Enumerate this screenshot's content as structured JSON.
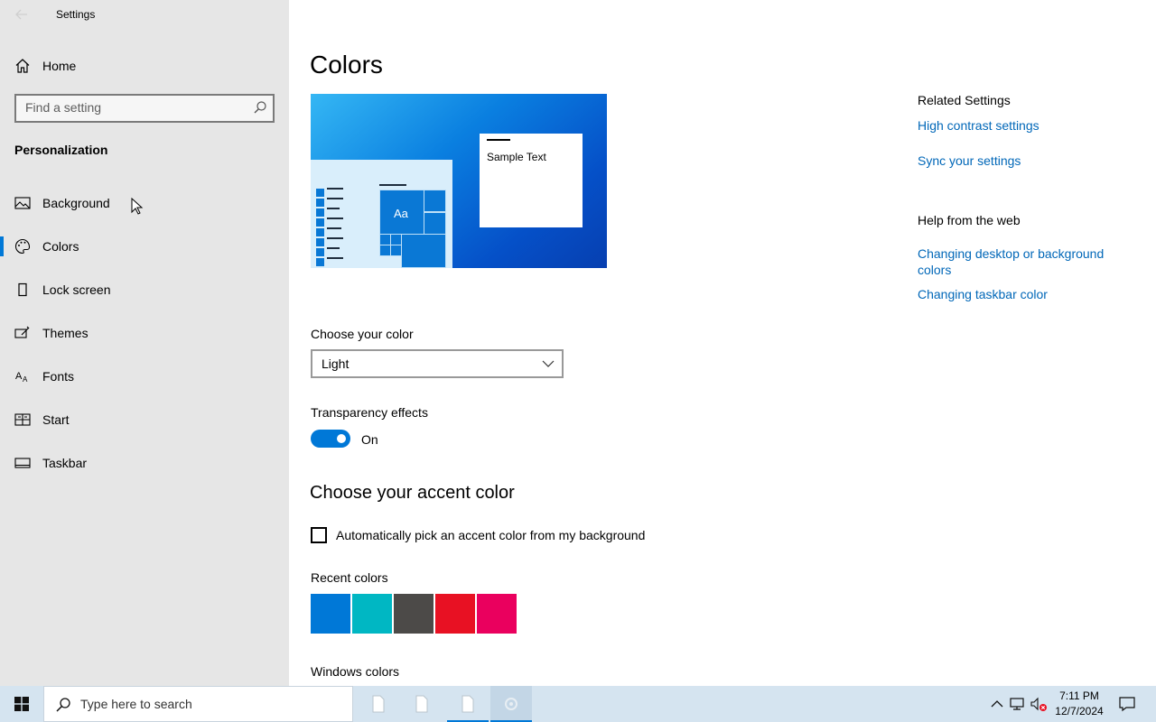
{
  "window": {
    "title": "Settings"
  },
  "sidebar": {
    "home_label": "Home",
    "search_placeholder": "Find a setting",
    "section_title": "Personalization",
    "items": [
      {
        "label": "Background",
        "icon": "picture-icon"
      },
      {
        "label": "Colors",
        "icon": "palette-icon",
        "selected": true
      },
      {
        "label": "Lock screen",
        "icon": "lock-screen-icon"
      },
      {
        "label": "Themes",
        "icon": "themes-icon"
      },
      {
        "label": "Fonts",
        "icon": "fonts-icon"
      },
      {
        "label": "Start",
        "icon": "start-icon"
      },
      {
        "label": "Taskbar",
        "icon": "taskbar-icon"
      }
    ]
  },
  "main": {
    "title": "Colors",
    "preview": {
      "sample_text": "Sample Text",
      "tile_label": "Aa"
    },
    "choose_color": {
      "label": "Choose your color",
      "value": "Light"
    },
    "transparency": {
      "label": "Transparency effects",
      "state": "On"
    },
    "accent": {
      "heading": "Choose your accent color",
      "auto_pick_label": "Automatically pick an accent color from my background",
      "auto_pick_checked": false,
      "recent_label": "Recent colors",
      "recent_colors": [
        "#0078d7",
        "#00b7c3",
        "#4c4a48",
        "#e81123",
        "#ea005e"
      ],
      "windows_colors_label": "Windows colors"
    }
  },
  "related": {
    "related_title": "Related Settings",
    "related_links": [
      "High contrast settings",
      "Sync your settings"
    ],
    "help_title": "Help from the web",
    "help_links": [
      "Changing desktop or background colors",
      "Changing taskbar color"
    ]
  },
  "taskbar": {
    "search_placeholder": "Type here to search",
    "time": "7:11 PM",
    "date": "12/7/2024"
  },
  "colors": {
    "accent": "#0078d7",
    "link": "#0067b8",
    "sidebar_bg": "#e6e6e6",
    "taskbar_bg": "#d5e4f0"
  }
}
